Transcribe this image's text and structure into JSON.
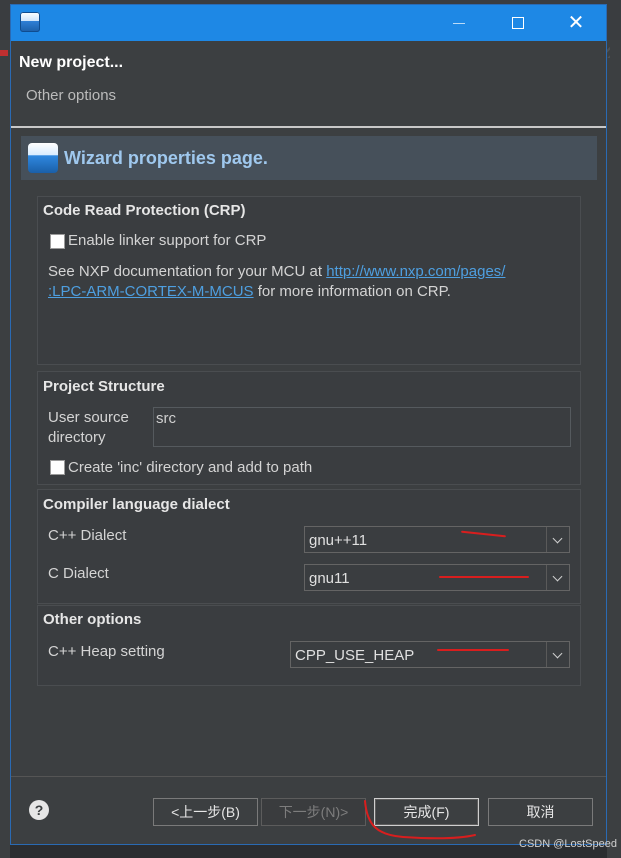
{
  "dialog": {
    "title": "New project...",
    "subtitle": "Other options",
    "banner_title": "Wizard properties page."
  },
  "crp": {
    "group_title": "Code Read Protection (CRP)",
    "enable_label": "Enable linker support for CRP",
    "enable_checked": false,
    "info_prefix": "See NXP documentation for your MCU at ",
    "info_link_line1": "http://www.nxp.com/pages/",
    "info_link_line2": ":LPC-ARM-CORTEX-M-MCUS",
    "info_suffix": " for more information on CRP."
  },
  "structure": {
    "group_title": "Project Structure",
    "source_dir_label_1": "User source",
    "source_dir_label_2": "directory",
    "source_dir_value": "src",
    "inc_label": "Create 'inc' directory and add to path",
    "inc_checked": false
  },
  "dialect": {
    "group_title": "Compiler language dialect",
    "cpp_label": "C++ Dialect",
    "cpp_value": "gnu++11",
    "c_label": "C Dialect",
    "c_value": "gnu11"
  },
  "other": {
    "group_title": "Other options",
    "heap_label": "C++ Heap setting",
    "heap_value": "CPP_USE_HEAP"
  },
  "footer": {
    "help_glyph": "?",
    "back_label": "<上一步(B)",
    "next_label": "下一步(N)>",
    "finish_label": "完成(F)",
    "cancel_label": "取消"
  },
  "watermark": "CSDN @LostSpeed",
  "colors": {
    "titlebar": "#1e88e5",
    "link": "#4e9fe0",
    "annotation_red": "#d81e1e"
  }
}
